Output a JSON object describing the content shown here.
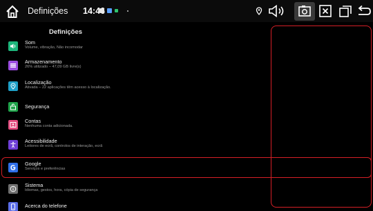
{
  "statusbar": {
    "title": "Definições",
    "time": "14:46",
    "notification_colors": [
      "#e8e8e8",
      "#5aa0ff",
      "#2ec46f",
      "#2ec46f"
    ],
    "icons": [
      "home-icon",
      "location-icon",
      "volume-icon",
      "screenshot-icon",
      "close-box-icon",
      "recent-apps-icon",
      "back-icon"
    ]
  },
  "settings": {
    "title": "Definições",
    "items": [
      {
        "icon": "volume-icon",
        "color": "#1db67b",
        "label": "Som",
        "sub": "Volume, vibração, Não incomodar"
      },
      {
        "icon": "storage-icon",
        "color": "#9c4de0",
        "label": "Armazenamento",
        "sub": "26% utilizado – 47,09 GB livre(s)"
      },
      {
        "icon": "location-pin-icon",
        "color": "#1ea0c8",
        "label": "Localização",
        "sub": "Ativada – 22 aplicações têm acesso à localização."
      },
      {
        "icon": "security-icon",
        "color": "#1fa34a",
        "label": "Segurança",
        "sub": ""
      },
      {
        "icon": "account-icon",
        "color": "#e24a7d",
        "label": "Contas",
        "sub": "Nenhuma conta adicionada."
      },
      {
        "icon": "accessibility-icon",
        "color": "#6f3fd8",
        "label": "Acessibilidade",
        "sub": "Leitores de ecrã, controlos de interação, ecrã"
      },
      {
        "icon": "google-icon",
        "color": "#2f6fe8",
        "label": "Google",
        "sub": "Serviços e preferências"
      },
      {
        "icon": "info-icon",
        "color": "#6f6f6f",
        "label": "Sistema",
        "sub": "Idiomas, gestos, hora, cópia de segurança"
      },
      {
        "icon": "phone-icon",
        "color": "#5a6de8",
        "label": "Acerca do telefone",
        "sub": ""
      }
    ]
  },
  "highlight_color": "#d61f26"
}
